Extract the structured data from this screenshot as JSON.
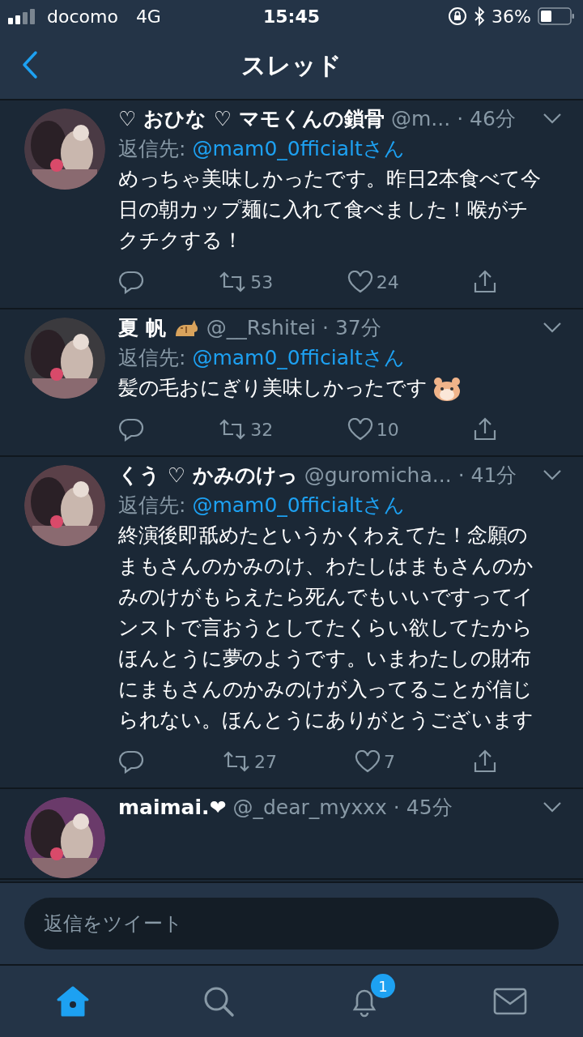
{
  "status_bar": {
    "carrier": "docomo",
    "network": "4G",
    "time": "15:45",
    "battery": "36%"
  },
  "nav": {
    "title": "スレッド"
  },
  "tweets": [
    {
      "name": "♡ おひな ♡ マモくんの鎖骨",
      "handle": "@m...",
      "time": "· 46分",
      "reply_label": "返信先:",
      "reply_to": "@mam0_0fficialtさん",
      "text": "めっちゃ美味しかったです。昨日2本食べて今日の朝カップ麺に入れて食べました！喉がチクチクする！",
      "retweets": "53",
      "likes": "24"
    },
    {
      "name": "夏 帆",
      "name_emoji": true,
      "handle": "@__Rshitei",
      "time": "· 37分",
      "reply_label": "返信先:",
      "reply_to": "@mam0_0fficialtさん",
      "text": "髪の毛おにぎり美味しかったです",
      "text_emoji": true,
      "retweets": "32",
      "likes": "10"
    },
    {
      "name": "くう ♡ かみのけっ",
      "handle": "@guromicha...",
      "time": "· 41分",
      "reply_label": "返信先:",
      "reply_to": "@mam0_0fficialtさん",
      "text": "終演後即舐めたというかくわえてた！念願のまもさんのかみのけ、わたしはまもさんのかみのけがもらえたら死んでもいいですってインストで言おうとしてたくらい欲してたからほんとうに夢のようです。いまわたしの財布にまもさんのかみのけが入ってることが信じられない。ほんとうにありがとうございます",
      "retweets": "27",
      "likes": "7"
    },
    {
      "name": "maimai.❤",
      "handle": "@_dear_myxxx",
      "time": "· 45分"
    }
  ],
  "reply_box": {
    "placeholder": "返信をツイート"
  },
  "tab_bar": [
    {
      "kind": "home",
      "selected": true
    },
    {
      "kind": "search",
      "selected": false
    },
    {
      "kind": "notifications",
      "selected": false,
      "badge": "1"
    },
    {
      "kind": "messages",
      "selected": false
    }
  ]
}
